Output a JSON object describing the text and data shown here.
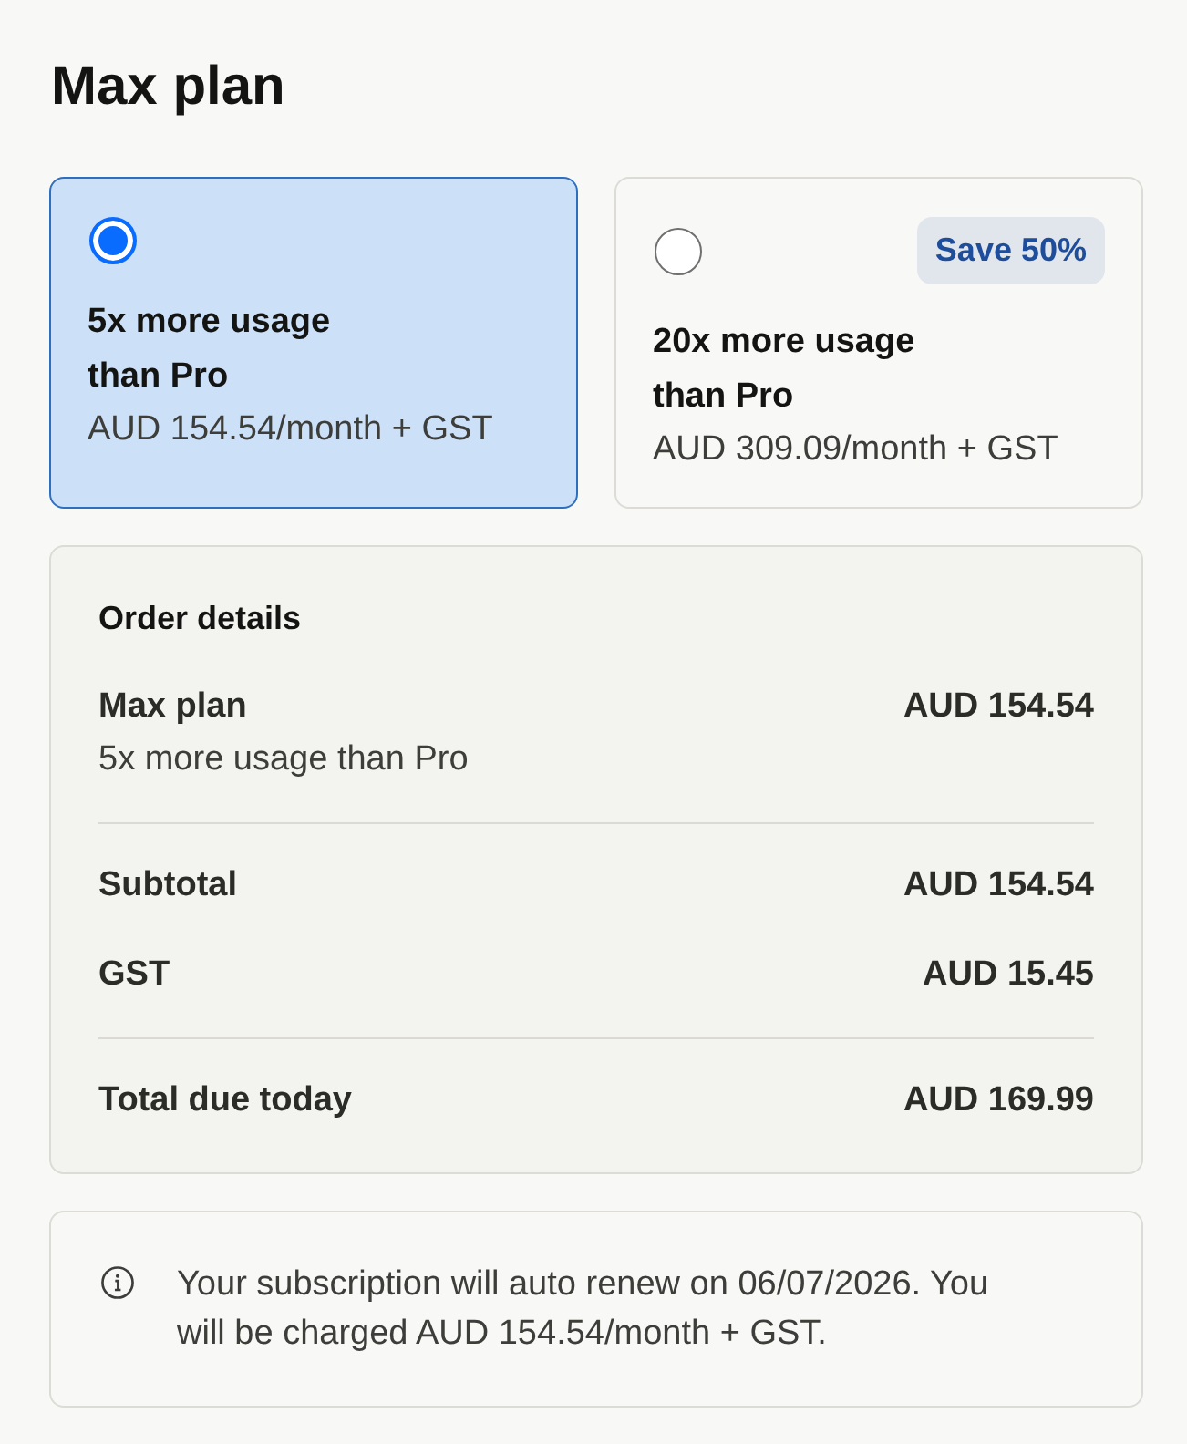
{
  "page_title": "Max plan",
  "plans": [
    {
      "title": "5x more usage than Pro",
      "price": "AUD 154.54/month + GST",
      "selected": true
    },
    {
      "title": "20x more usage than Pro",
      "price": "AUD 309.09/month + GST",
      "selected": false,
      "badge": "Save 50%"
    }
  ],
  "order_details": {
    "title": "Order details",
    "item": {
      "name": "Max plan",
      "description": "5x more usage than Pro",
      "amount": "AUD 154.54"
    },
    "lines": [
      {
        "label": "Subtotal",
        "amount": "AUD 154.54"
      },
      {
        "label": "GST",
        "amount": "AUD 15.45"
      }
    ],
    "total": {
      "label": "Total due today",
      "amount": "AUD 169.99"
    }
  },
  "notice": {
    "text": "Your subscription will auto renew on 06/07/2026. You will be charged AUD 154.54/month + GST."
  }
}
